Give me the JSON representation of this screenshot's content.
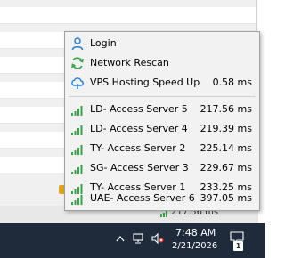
{
  "menu": {
    "login_label": "Login",
    "rescan_label": "Network Rescan",
    "speed_label": "VPS Hosting Speed Up",
    "speed_value": "0.58 ms",
    "servers": [
      {
        "label": "LD- Access Server 5",
        "value": "217.56 ms"
      },
      {
        "label": "LD- Access Server 4",
        "value": "219.39 ms"
      },
      {
        "label": "TY- Access Server 2",
        "value": "225.14 ms"
      },
      {
        "label": "SG- Access Server 3",
        "value": "229.67 ms"
      },
      {
        "label": "TY- Access Server 1",
        "value": "233.25 ms"
      },
      {
        "label": "UAE- Access Server 6",
        "value": "397.05 ms"
      }
    ]
  },
  "status_bar": {
    "ping": "217.56 ms"
  },
  "taskbar": {
    "time": "7:48 AM",
    "date": "2/21/2026",
    "notification_count": "1"
  },
  "colors": {
    "signal": "#3aa34a",
    "accent": "#2a7fd4",
    "taskbar": "#1f2a3a"
  }
}
